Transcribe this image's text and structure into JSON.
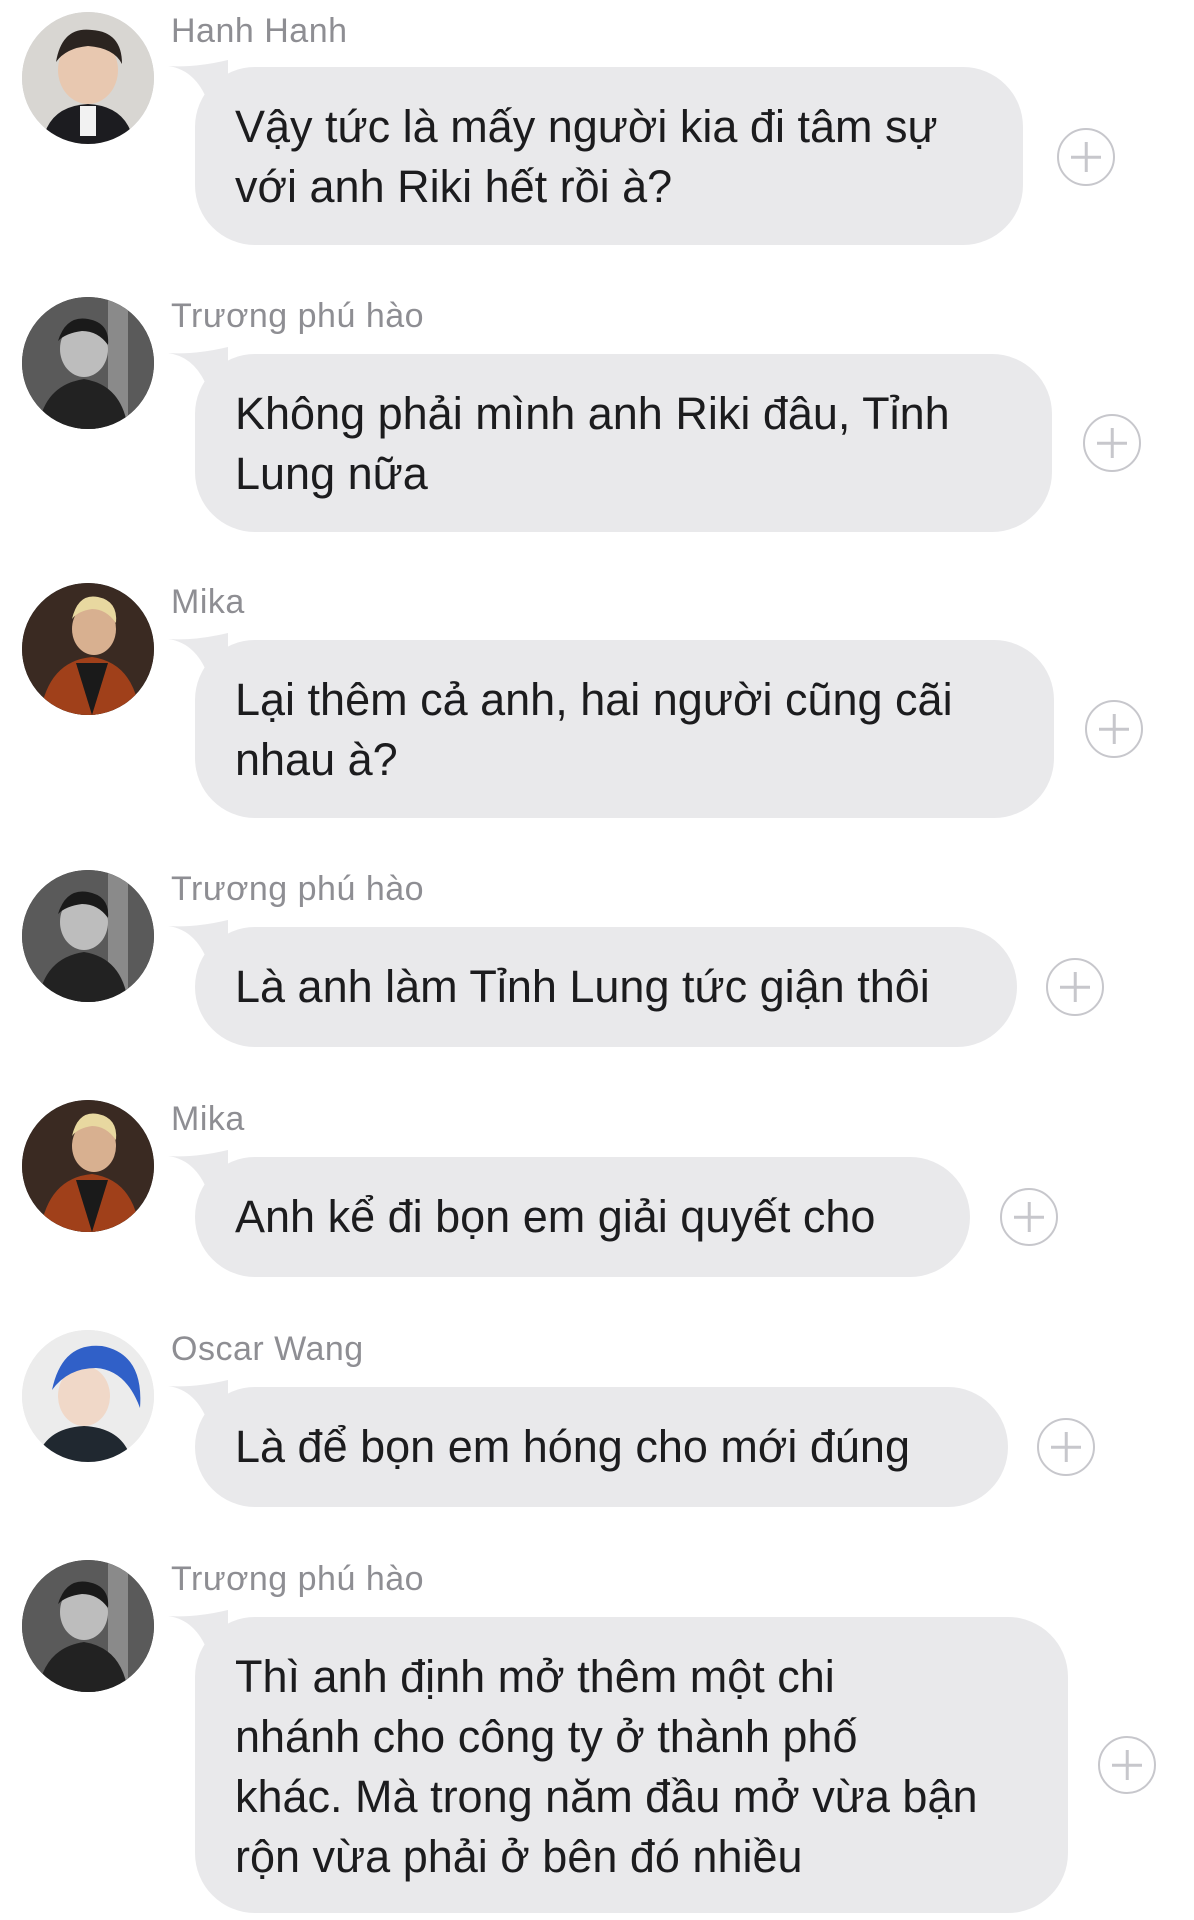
{
  "messages": [
    {
      "sender": "Hanh Hanh",
      "avatar": "avatar-hanh-hanh",
      "lines": [
        "Vậy tức là mấy người kia đi tâm sự",
        "với anh Riki hết rồi à?"
      ]
    },
    {
      "sender": "Trương phú hào",
      "avatar": "avatar-truong-phu-hao",
      "lines": [
        "Không phải mình anh Riki đâu, Tỉnh",
        "Lung nữa"
      ]
    },
    {
      "sender": "Mika",
      "avatar": "avatar-mika",
      "lines": [
        "Lại thêm cả anh, hai người cũng cãi",
        "nhau à?"
      ]
    },
    {
      "sender": "Trương phú hào",
      "avatar": "avatar-truong-phu-hao",
      "lines": [
        "Là anh làm Tỉnh Lung tức giận thôi"
      ]
    },
    {
      "sender": "Mika",
      "avatar": "avatar-mika",
      "lines": [
        "Anh kể đi bọn em giải quyết cho"
      ]
    },
    {
      "sender": "Oscar Wang",
      "avatar": "avatar-oscar-wang",
      "lines": [
        "Là để bọn em hóng cho mới đúng"
      ]
    },
    {
      "sender": "Trương phú hào",
      "avatar": "avatar-truong-phu-hao",
      "lines": [
        "Thì anh định mở thêm một chi",
        "nhánh cho công ty ở thành phố",
        "khác. Mà trong năm đầu mở vừa bận",
        "rộn vừa phải ở bên đó nhiều"
      ]
    }
  ],
  "colors": {
    "bubble": "#e9e9eb",
    "sender_text": "#8e8e93",
    "message_text": "#1c1c1e",
    "add_icon": "#c7c7cc"
  }
}
